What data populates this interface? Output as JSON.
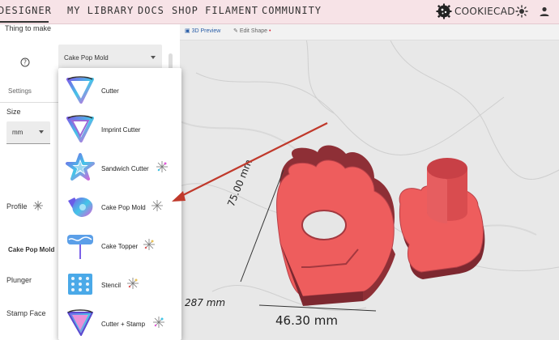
{
  "nav": {
    "designer": "DESIGNER",
    "my_library": "MY LIBRARY",
    "docs": "DOCS",
    "shop_filament": "SHOP FILAMENT",
    "community": "COMMUNITY",
    "brand": "COOKIECAD"
  },
  "left": {
    "thing_label": "Thing to make",
    "thing_value": "Cake Pop Mold",
    "settings_label": "Settings",
    "size_label": "Size",
    "size_value": "mm",
    "profile_label": "Profile",
    "section_label": "Cake Pop Mold",
    "plunger_label": "Plunger",
    "stamp_face_label": "Stamp Face"
  },
  "dropdown": {
    "items": [
      {
        "label": "Cutter",
        "new": false
      },
      {
        "label": "Imprint Cutter",
        "new": false
      },
      {
        "label": "Sandwich Cutter",
        "new": true
      },
      {
        "label": "Cake Pop Mold",
        "new": true
      },
      {
        "label": "Cake Topper",
        "new": true
      },
      {
        "label": "Stencil",
        "new": true
      },
      {
        "label": "Cutter + Stamp",
        "new": true
      }
    ]
  },
  "preview": {
    "tab_3d": "3D Preview",
    "tab_edit": "Edit Shape",
    "dim_height": "75.00 mm",
    "dim_width": "46.30 mm",
    "dim_left": "287 mm"
  },
  "colors": {
    "nav_bg": "#f7e3e7",
    "mold_red": "#ee5d5d",
    "arrow": "#c0392b",
    "accent_blue": "#2b5fa8"
  }
}
